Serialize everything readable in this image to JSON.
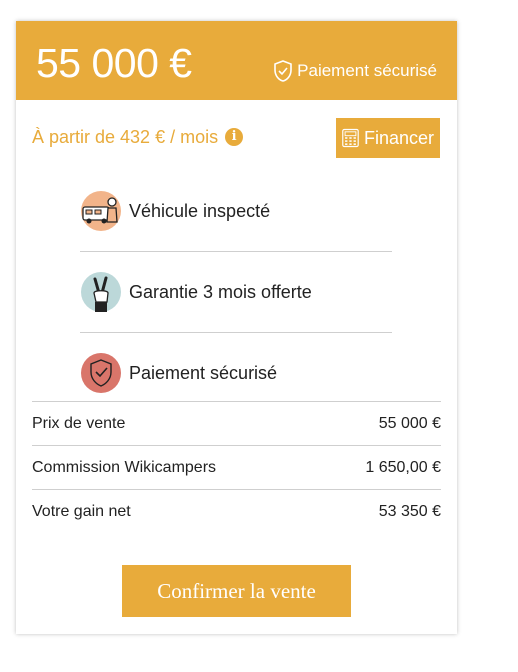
{
  "header": {
    "price": "55 000 €",
    "secure_label": "Paiement sécurisé"
  },
  "financing": {
    "monthly_text": "À partir de 432 € / mois",
    "info_icon": "i",
    "finance_button": "Financer"
  },
  "features": [
    {
      "label": "Véhicule inspecté",
      "icon": "inspection-van-icon"
    },
    {
      "label": "Garantie 3 mois offerte",
      "icon": "peace-hand-icon"
    },
    {
      "label": "Paiement sécurisé",
      "icon": "shield-check-icon"
    }
  ],
  "summary": {
    "rows": [
      {
        "label": "Prix de vente",
        "value": "55 000 €"
      },
      {
        "label": "Commission Wikicampers",
        "value": "1 650,00 €"
      },
      {
        "label": "Votre gain net",
        "value": "53 350 €"
      }
    ]
  },
  "confirm_button": "Confirmer la vente",
  "colors": {
    "accent": "#e8ab3b",
    "feature1_bg": "#f2b48a",
    "feature2_bg": "#bcd8d9",
    "feature3_bg": "#d9756a"
  }
}
